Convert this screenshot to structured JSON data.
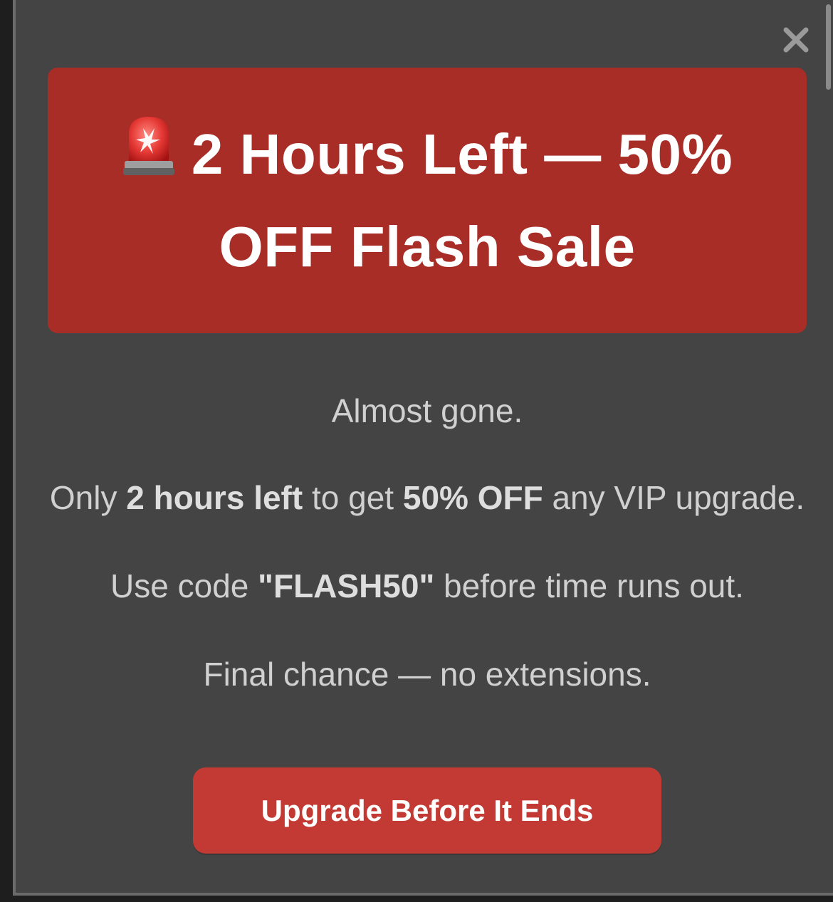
{
  "modal": {
    "close_icon": "close-icon",
    "banner": {
      "icon": "siren-icon",
      "title": "2 Hours Left — 50% OFF Flash Sale"
    },
    "body": {
      "line1": "Almost gone.",
      "line2": {
        "pre": "Only ",
        "bold1": "2 hours left",
        "mid": " to get ",
        "bold2": "50% OFF",
        "post": " any VIP upgrade."
      },
      "line3": {
        "pre": "Use code ",
        "code": "\"FLASH50\"",
        "post": " before time runs out."
      },
      "line4": "Final chance — no extensions."
    },
    "cta_label": "Upgrade Before It Ends"
  },
  "colors": {
    "banner_bg": "#a82d27",
    "cta_bg": "#c23a33",
    "modal_bg": "#444444"
  }
}
